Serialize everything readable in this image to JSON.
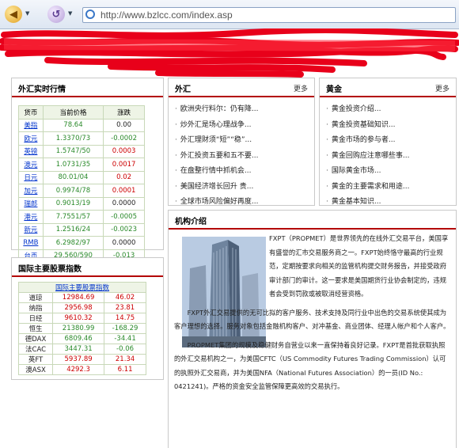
{
  "browser": {
    "url": "http://www.bzlcc.com/index.asp"
  },
  "forex_panel": {
    "title": "外汇实时行情",
    "headers": [
      "货币",
      "当前价格",
      "涨跌"
    ],
    "rows": [
      {
        "currency": "美指",
        "price": "78.64",
        "change": "0.00",
        "color": "#222222"
      },
      {
        "currency": "欧元",
        "price": "1.3370/73",
        "change": "-0.0002",
        "color": "#2a8a2a"
      },
      {
        "currency": "英镑",
        "price": "1.5747/50",
        "change": "0.0003",
        "color": "#cc0000"
      },
      {
        "currency": "澳元",
        "price": "1.0731/35",
        "change": "0.0017",
        "color": "#cc0000"
      },
      {
        "currency": "日元",
        "price": "80.01/04",
        "change": "0.02",
        "color": "#cc0000"
      },
      {
        "currency": "加元",
        "price": "0.9974/78",
        "change": "0.0001",
        "color": "#cc0000"
      },
      {
        "currency": "瑞郎",
        "price": "0.9013/19",
        "change": "0.0000",
        "color": "#222222"
      },
      {
        "currency": "港元",
        "price": "7.7551/57",
        "change": "-0.0005",
        "color": "#2a8a2a"
      },
      {
        "currency": "新元",
        "price": "1.2516/24",
        "change": "-0.0023",
        "color": "#2a8a2a"
      },
      {
        "currency": "RMB",
        "price": "6.2982/97",
        "change": "0.0000",
        "color": "#222222"
      },
      {
        "currency": "台币",
        "price": "29.560/590",
        "change": "-0.013",
        "color": "#2a8a2a"
      }
    ]
  },
  "stocks_panel": {
    "title": "国际主要股票指数",
    "table_header": "国际主要股票指数",
    "rows": [
      {
        "name": "道琼",
        "value": "12984.69",
        "change": "46.02",
        "color": "#cc0000"
      },
      {
        "name": "纳指",
        "value": "2956.98",
        "change": "23.81",
        "color": "#cc0000"
      },
      {
        "name": "日经",
        "value": "9610.32",
        "change": "14.75",
        "color": "#cc0000"
      },
      {
        "name": "恒生",
        "value": "21380.99",
        "change": "-168.29",
        "color": "#2a8a2a"
      },
      {
        "name": "德DAX",
        "value": "6809.46",
        "change": "-34.41",
        "color": "#2a8a2a"
      },
      {
        "name": "法CAC",
        "value": "3447.31",
        "change": "-0.06",
        "color": "#2a8a2a"
      },
      {
        "name": "英FT",
        "value": "5937.89",
        "change": "21.34",
        "color": "#cc0000"
      },
      {
        "name": "澳ASX",
        "value": "4292.3",
        "change": "6.11",
        "color": "#cc0000"
      }
    ]
  },
  "waihui_panel": {
    "title": "外汇",
    "more": "更多",
    "items": [
      "欧洲央行料尔：仍有降...",
      "炒外汇是场心理战争...",
      "外汇理财须“短”“稳”...",
      "外汇投资五要和五不要...",
      "在盘整行情中抓机会...",
      "美国经济增长回升 贵...",
      "全球市场风险偏好再度..."
    ]
  },
  "gold_panel": {
    "title": "黄金",
    "more": "更多",
    "items": [
      "黄金投资介绍...",
      "黄金投资基础知识...",
      "黄金市场的参与者...",
      "黄金回购应注意哪些事...",
      "国际黄金市场...",
      "黄金的主要需求和用途...",
      "黄金基本知识..."
    ]
  },
  "about_panel": {
    "title": "机构介绍",
    "paragraphs": [
      "FXPT（PROPMET）是世界领先的在线外汇交易平台，美国享有盛誉的汇市交易服务商之一。FXPT始终恪守最高的行业规范，定期按要求向相关的监管机构提交财务报告，并接受政府审计部门的审计。这一要求是美国期货行业协会制定的，违规者会受到罚款或被取消经营资格。",
      "FXPT外汇交易提供的无可比拟的客户服务、技术支持及同行业中出色的交易系统使其成为客户理想的选择。服务对象包括金融机构客户、对冲基金、商业团体、经理人帐户和个人客户。",
      "PROPMET集团的规模及稳健财务自营业以来一直保持着良好记录。FXPT是首批获取执照的外汇交易机构之一，为美国CFTC（US Commodity Futures Trading Commission）认可的执照外汇交易商，并为美国NFA（National Futures Association）的一员(ID No.: 0421241)。严格的资金安全监管保障更高效的交易执行。"
    ]
  }
}
